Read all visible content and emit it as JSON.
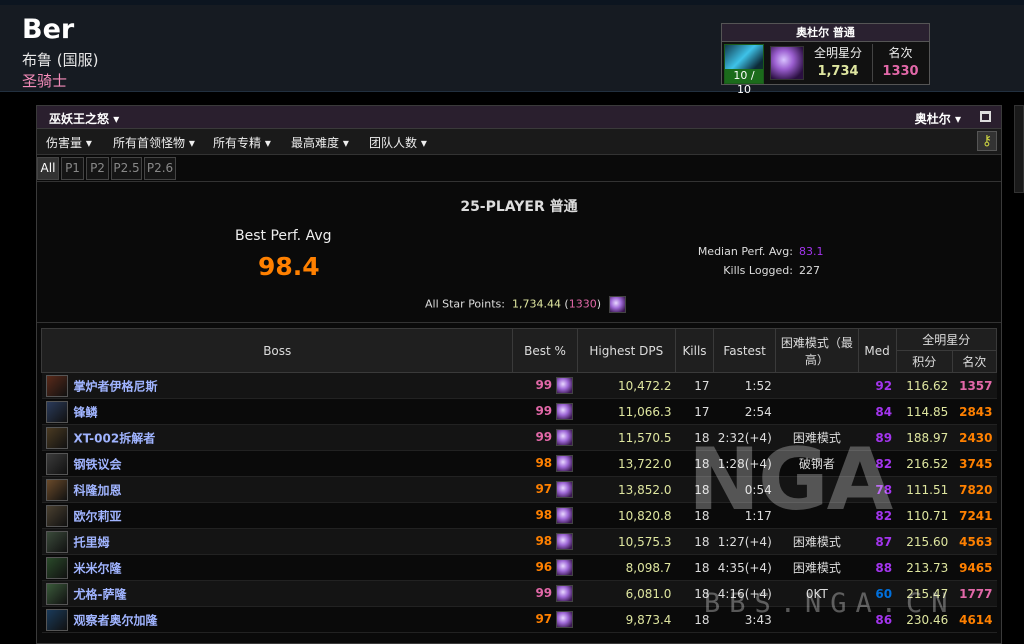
{
  "header": {
    "char_name": "Ber",
    "realm": "布鲁 (国服)",
    "char_class": "圣骑士",
    "zone_box": {
      "title": "奥杜尔 普通",
      "progress": "10 / 10",
      "star_label": "全明星分",
      "star_value": "1,734",
      "rank_label": "名次",
      "rank_value": "1330"
    }
  },
  "panel": {
    "expansion": "巫妖王之怒",
    "zone": "奥杜尔",
    "filters": [
      "伤害量",
      "所有首领怪物",
      "所有专精",
      "最高难度",
      "团队人数"
    ],
    "tabs": [
      "All",
      "P1",
      "P2",
      "P2.5",
      "P2.6"
    ],
    "active_tab": "All"
  },
  "summary": {
    "difficulty": "25-PLAYER 普通",
    "best_label": "Best Perf. Avg",
    "best_value": "98.4",
    "median_label": "Median Perf. Avg:",
    "median_value": "83.1",
    "kills_label": "Kills Logged:",
    "kills_value": "227",
    "allstar_label": "All Star Points:",
    "allstar_value": "1,734.44",
    "allstar_rank": "1330"
  },
  "table": {
    "headers": {
      "boss": "Boss",
      "best": "Best %",
      "dps": "Highest DPS",
      "kills": "Kills",
      "fastest": "Fastest",
      "mode": "困难模式（最高）",
      "med": "Med",
      "allstar": "全明星分",
      "score": "积分",
      "rank": "名次"
    },
    "rows": [
      {
        "boss": "掌炉者伊格尼斯",
        "best": "99",
        "dps": "10,472.2",
        "kills": "17",
        "fastest": "1:52",
        "mode": "",
        "med": "92",
        "score": "116.62",
        "rank": "1357"
      },
      {
        "boss": "锋鳞",
        "best": "99",
        "dps": "11,066.3",
        "kills": "17",
        "fastest": "2:54",
        "mode": "",
        "med": "84",
        "score": "114.85",
        "rank": "2843"
      },
      {
        "boss": "XT-002拆解者",
        "best": "99",
        "dps": "11,570.5",
        "kills": "18",
        "fastest": "2:32(+4)",
        "mode": "困难模式",
        "med": "89",
        "score": "188.97",
        "rank": "2430"
      },
      {
        "boss": "钢铁议会",
        "best": "98",
        "dps": "13,722.0",
        "kills": "18",
        "fastest": "1:28(+4)",
        "mode": "破钢者",
        "med": "82",
        "score": "216.52",
        "rank": "3745"
      },
      {
        "boss": "科隆加恩",
        "best": "97",
        "dps": "13,852.0",
        "kills": "18",
        "fastest": "0:54",
        "mode": "",
        "med": "78",
        "score": "111.51",
        "rank": "7820"
      },
      {
        "boss": "欧尔莉亚",
        "best": "98",
        "dps": "10,820.8",
        "kills": "18",
        "fastest": "1:17",
        "mode": "",
        "med": "82",
        "score": "110.71",
        "rank": "7241"
      },
      {
        "boss": "托里姆",
        "best": "98",
        "dps": "10,575.3",
        "kills": "18",
        "fastest": "1:27(+4)",
        "mode": "困难模式",
        "med": "87",
        "score": "215.60",
        "rank": "4563"
      },
      {
        "boss": "米米尔隆",
        "best": "96",
        "dps": "8,098.7",
        "kills": "18",
        "fastest": "4:35(+4)",
        "mode": "困难模式",
        "med": "88",
        "score": "213.73",
        "rank": "9465"
      },
      {
        "boss": "尤格-萨隆",
        "best": "99",
        "dps": "6,081.0",
        "kills": "18",
        "fastest": "4:16(+4)",
        "mode": "0KT",
        "med": "60",
        "score": "215.47",
        "rank": "1777"
      },
      {
        "boss": "观察者奥尔加隆",
        "best": "97",
        "dps": "9,873.4",
        "kills": "18",
        "fastest": "3:43",
        "mode": "",
        "med": "86",
        "score": "230.46",
        "rank": "4614"
      }
    ]
  },
  "colors": {
    "legendary": "#ff8000",
    "artifact": "#e268a8",
    "epic": "#a335ee",
    "rare": "#0070dd",
    "score": "#dfe6a0"
  },
  "watermark": {
    "text": "NGA",
    "sub": "BBS.NGA.CN"
  }
}
